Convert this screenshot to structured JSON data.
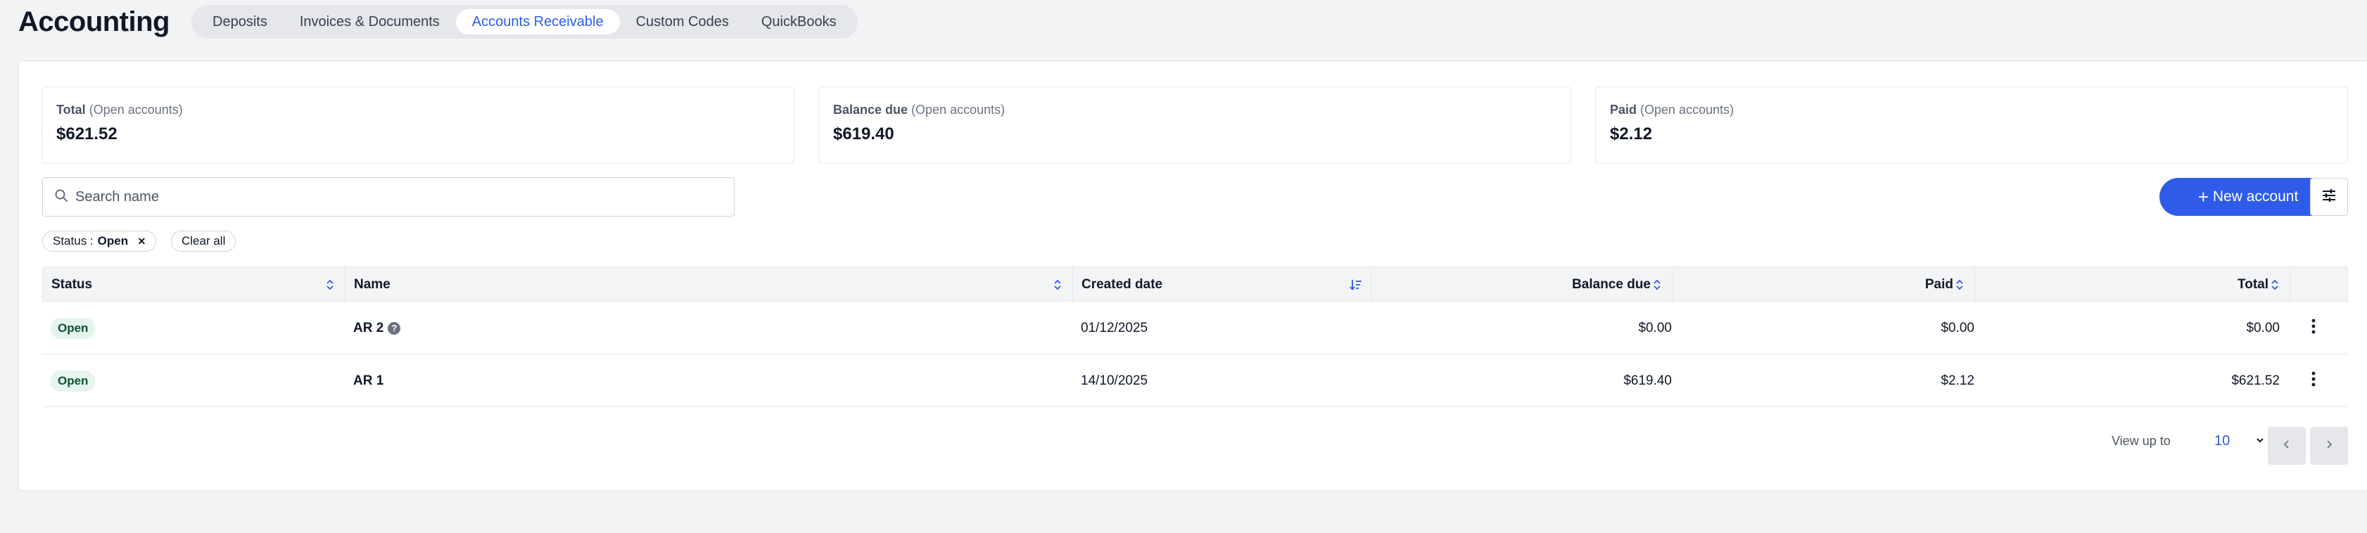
{
  "header": {
    "title": "Accounting",
    "tabs": [
      {
        "label": "Deposits"
      },
      {
        "label": "Invoices & Documents"
      },
      {
        "label": "Accounts Receivable"
      },
      {
        "label": "Custom Codes"
      },
      {
        "label": "QuickBooks"
      }
    ],
    "active_tab": "Accounts Receivable"
  },
  "summary": {
    "total": {
      "label": "Total",
      "sub": "(Open accounts)",
      "value": "$621.52"
    },
    "balance_due": {
      "label": "Balance due",
      "sub": "(Open accounts)",
      "value": "$619.40"
    },
    "paid": {
      "label": "Paid",
      "sub": "(Open accounts)",
      "value": "$2.12"
    }
  },
  "search": {
    "placeholder": "Search name",
    "value": ""
  },
  "toolbar": {
    "new_account_label": "New account",
    "new_account_icon": "plus-icon",
    "filter_icon": "sliders-icon"
  },
  "filters": {
    "status_chip": {
      "label": "Status :",
      "value": "Open"
    },
    "clear_all_label": "Clear all"
  },
  "table": {
    "columns": [
      {
        "label": "Status"
      },
      {
        "label": "Name"
      },
      {
        "label": "Created date"
      },
      {
        "label": "Balance due"
      },
      {
        "label": "Paid"
      },
      {
        "label": "Total"
      }
    ],
    "rows": [
      {
        "status": "Open",
        "name": "AR 2",
        "created": "01/12/2025",
        "balance_due": "$0.00",
        "paid": "$0.00",
        "total": "$0.00"
      },
      {
        "status": "Open",
        "name": "AR 1",
        "created": "14/10/2025",
        "balance_due": "$619.40",
        "paid": "$2.12",
        "total": "$621.52"
      }
    ]
  },
  "pagination": {
    "label": "View up to",
    "page_size": "10"
  },
  "colors": {
    "accent": "#2f5bea",
    "badge_bg": "#e6f4ee",
    "badge_text": "#0f5132"
  }
}
